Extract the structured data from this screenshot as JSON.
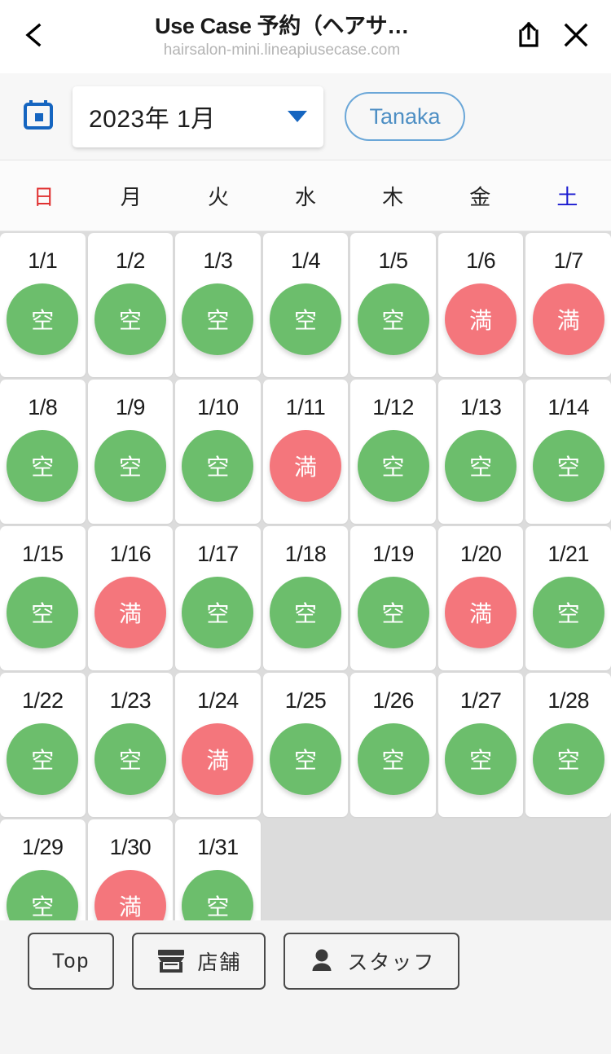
{
  "browser_bar": {
    "back_icon": "chevron-left-icon",
    "title": "Use Case 予約（ヘアサ…",
    "url": "hairsalon-mini.lineapiusecase.com",
    "share_icon": "share-icon",
    "close_icon": "close-icon"
  },
  "controls": {
    "calendar_icon": "calendar-icon",
    "month_value": "2023年 1月",
    "dropdown_icon": "chevron-down-icon",
    "staff_label": "Tanaka",
    "accent_blue": "#1565c0",
    "pill_blue": "#4e8fc4"
  },
  "weekdays": [
    {
      "label": "日",
      "type": "sun"
    },
    {
      "label": "月",
      "type": "wd"
    },
    {
      "label": "火",
      "type": "wd"
    },
    {
      "label": "水",
      "type": "wd"
    },
    {
      "label": "木",
      "type": "wd"
    },
    {
      "label": "金",
      "type": "wd"
    },
    {
      "label": "土",
      "type": "sat"
    }
  ],
  "legend": {
    "open_label": "空",
    "full_label": "満",
    "open_color": "#6cbe6c",
    "full_color": "#f4767c"
  },
  "calendar": {
    "days": [
      {
        "date": "1/1",
        "status": "空"
      },
      {
        "date": "1/2",
        "status": "空"
      },
      {
        "date": "1/3",
        "status": "空"
      },
      {
        "date": "1/4",
        "status": "空"
      },
      {
        "date": "1/5",
        "status": "空"
      },
      {
        "date": "1/6",
        "status": "満"
      },
      {
        "date": "1/7",
        "status": "満"
      },
      {
        "date": "1/8",
        "status": "空"
      },
      {
        "date": "1/9",
        "status": "空"
      },
      {
        "date": "1/10",
        "status": "空"
      },
      {
        "date": "1/11",
        "status": "満"
      },
      {
        "date": "1/12",
        "status": "空"
      },
      {
        "date": "1/13",
        "status": "空"
      },
      {
        "date": "1/14",
        "status": "空"
      },
      {
        "date": "1/15",
        "status": "空"
      },
      {
        "date": "1/16",
        "status": "満"
      },
      {
        "date": "1/17",
        "status": "空"
      },
      {
        "date": "1/18",
        "status": "空"
      },
      {
        "date": "1/19",
        "status": "空"
      },
      {
        "date": "1/20",
        "status": "満"
      },
      {
        "date": "1/21",
        "status": "空"
      },
      {
        "date": "1/22",
        "status": "空"
      },
      {
        "date": "1/23",
        "status": "空"
      },
      {
        "date": "1/24",
        "status": "満"
      },
      {
        "date": "1/25",
        "status": "空"
      },
      {
        "date": "1/26",
        "status": "空"
      },
      {
        "date": "1/27",
        "status": "空"
      },
      {
        "date": "1/28",
        "status": "空"
      },
      {
        "date": "1/29",
        "status": "空"
      },
      {
        "date": "1/30",
        "status": "満"
      },
      {
        "date": "1/31",
        "status": "空"
      },
      {
        "date": "",
        "status": ""
      },
      {
        "date": "",
        "status": ""
      },
      {
        "date": "",
        "status": ""
      },
      {
        "date": "",
        "status": ""
      }
    ]
  },
  "bottom_nav": [
    {
      "label": "Top",
      "icon": null
    },
    {
      "label": "店舗",
      "icon": "store-icon"
    },
    {
      "label": "スタッフ",
      "icon": "person-icon"
    }
  ]
}
